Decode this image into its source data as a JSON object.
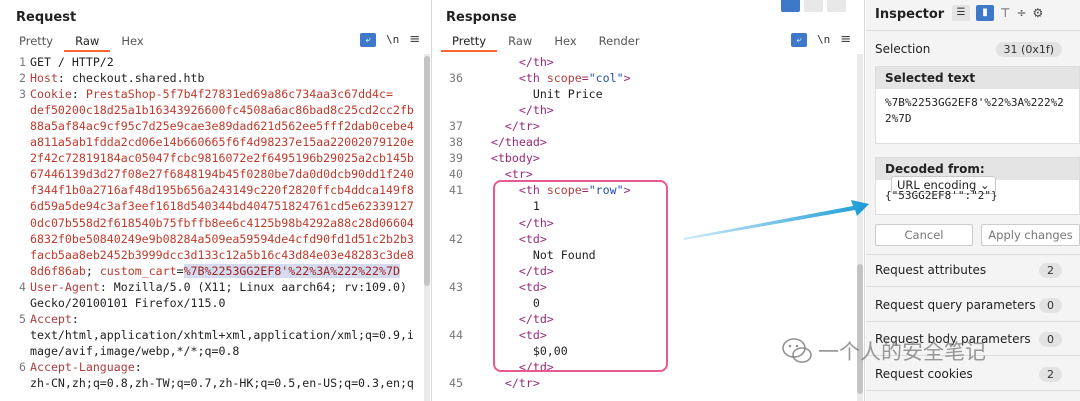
{
  "request": {
    "title": "Request",
    "tabs": [
      "Pretty",
      "Raw",
      "Hex"
    ],
    "active_tab": "Raw",
    "newline_label": "\\n",
    "lines": [
      {
        "n": "1",
        "parts": [
          {
            "c": "v",
            "t": "GET / HTTP/2"
          }
        ]
      },
      {
        "n": "2",
        "parts": [
          {
            "c": "k",
            "t": "Host"
          },
          {
            "c": "v",
            "t": ": checkout.shared.htb"
          }
        ]
      },
      {
        "n": "3",
        "parts": [
          {
            "c": "k",
            "t": "Cookie"
          },
          {
            "c": "v",
            "t": ": "
          },
          {
            "c": "ck",
            "t": "PrestaShop-5f7b4f27831ed69a86c734aa3c67dd4c="
          }
        ]
      },
      {
        "n": "",
        "parts": [
          {
            "c": "ck",
            "t": "def50200c18d25a1b16343926600fc4508a6ac86bad8c25cd2cc2fb"
          }
        ]
      },
      {
        "n": "",
        "parts": [
          {
            "c": "ck",
            "t": "88a5af84ac9cf95c7d25e9cae3e89dad621d562ee5fff2dab0cebe4"
          }
        ]
      },
      {
        "n": "",
        "parts": [
          {
            "c": "ck",
            "t": "a811a5ab1fdda2cd06e14b660665f6f4d98237e15aa22002079120e"
          }
        ]
      },
      {
        "n": "",
        "parts": [
          {
            "c": "ck",
            "t": "2f42c72819184ac05047fcbc9816072e2f6495196b29025a2cb145b"
          }
        ]
      },
      {
        "n": "",
        "parts": [
          {
            "c": "ck",
            "t": "67446139d3d27f08e27f6848194b45f0280be7da0d0dcb90dd1f240"
          }
        ]
      },
      {
        "n": "",
        "parts": [
          {
            "c": "ck",
            "t": "f344f1b0a2716af48d195b656a243149c220f2820ffcb4ddca149f8"
          }
        ]
      },
      {
        "n": "",
        "parts": [
          {
            "c": "ck",
            "t": "6d59a5de94c3af3eef1618d540344bd404751824761cd5e62339127"
          }
        ]
      },
      {
        "n": "",
        "parts": [
          {
            "c": "ck",
            "t": "0dc07b558d2f618540b75fbffb8ee6c4125b98b4292a88c28d06604"
          }
        ]
      },
      {
        "n": "",
        "parts": [
          {
            "c": "ck",
            "t": "6832f0be50840249e9b08284a509ea59594de4cfd90fd1d51c2b2b3"
          }
        ]
      },
      {
        "n": "",
        "parts": [
          {
            "c": "ck",
            "t": "facb5aa8eb2452b3999dcc3d133c12a5b16c43d84e03e48283c3de8"
          }
        ]
      },
      {
        "n": "",
        "parts": [
          {
            "c": "ck",
            "t": "8d6f86ab"
          },
          {
            "c": "v",
            "t": "; "
          },
          {
            "c": "ck",
            "t": "custom_cart"
          },
          {
            "c": "v",
            "t": "="
          },
          {
            "c": "hl",
            "t": "%7B%2253GG2EF8'%22%3A%222%22%7D"
          }
        ]
      },
      {
        "n": "4",
        "parts": [
          {
            "c": "k",
            "t": "User-Agent"
          },
          {
            "c": "v",
            "t": ": Mozilla/5.0 (X11; Linux aarch64; rv:109.0)"
          }
        ]
      },
      {
        "n": "",
        "parts": [
          {
            "c": "v",
            "t": "Gecko/20100101 Firefox/115.0"
          }
        ]
      },
      {
        "n": "5",
        "parts": [
          {
            "c": "k",
            "t": "Accept"
          },
          {
            "c": "v",
            "t": ":"
          }
        ]
      },
      {
        "n": "",
        "parts": [
          {
            "c": "v",
            "t": "text/html,application/xhtml+xml,application/xml;q=0.9,i"
          }
        ]
      },
      {
        "n": "",
        "parts": [
          {
            "c": "v",
            "t": "mage/avif,image/webp,*/*;q=0.8"
          }
        ]
      },
      {
        "n": "6",
        "parts": [
          {
            "c": "k",
            "t": "Accept-Language"
          },
          {
            "c": "v",
            "t": ":"
          }
        ]
      },
      {
        "n": "",
        "parts": [
          {
            "c": "v",
            "t": "zh-CN,zh;q=0.8,zh-TW;q=0.7,zh-HK;q=0.5,en-US;q=0.3,en;q"
          }
        ]
      }
    ]
  },
  "response": {
    "title": "Response",
    "tabs": [
      "Pretty",
      "Raw",
      "Hex",
      "Render"
    ],
    "active_tab": "Pretty",
    "newline_label": "\\n",
    "lines": [
      {
        "n": "",
        "parts": [
          {
            "c": "tag",
            "t": "      </th>"
          }
        ]
      },
      {
        "n": "36",
        "parts": [
          {
            "c": "tag",
            "t": "      <th "
          },
          {
            "c": "an",
            "t": "scope"
          },
          {
            "c": "tag",
            "t": "="
          },
          {
            "c": "av",
            "t": "\"col\""
          },
          {
            "c": "tag",
            "t": ">"
          }
        ]
      },
      {
        "n": "",
        "parts": [
          {
            "c": "v",
            "t": "        Unit Price"
          }
        ]
      },
      {
        "n": "",
        "parts": [
          {
            "c": "tag",
            "t": "      </th>"
          }
        ]
      },
      {
        "n": "37",
        "parts": [
          {
            "c": "tag",
            "t": "    </tr>"
          }
        ]
      },
      {
        "n": "38",
        "parts": [
          {
            "c": "tag",
            "t": "  </thead>"
          }
        ]
      },
      {
        "n": "39",
        "parts": [
          {
            "c": "tag",
            "t": "  <tbody>"
          }
        ]
      },
      {
        "n": "40",
        "parts": [
          {
            "c": "tag",
            "t": "    <tr>"
          }
        ]
      },
      {
        "n": "41",
        "parts": [
          {
            "c": "tag",
            "t": "      <th "
          },
          {
            "c": "an",
            "t": "scope"
          },
          {
            "c": "tag",
            "t": "="
          },
          {
            "c": "av",
            "t": "\"row\""
          },
          {
            "c": "tag",
            "t": ">"
          }
        ]
      },
      {
        "n": "",
        "parts": [
          {
            "c": "v",
            "t": "        1"
          }
        ]
      },
      {
        "n": "",
        "parts": [
          {
            "c": "tag",
            "t": "      </th>"
          }
        ]
      },
      {
        "n": "42",
        "parts": [
          {
            "c": "tag",
            "t": "      <td>"
          }
        ]
      },
      {
        "n": "",
        "parts": [
          {
            "c": "v",
            "t": "        Not Found"
          }
        ]
      },
      {
        "n": "",
        "parts": [
          {
            "c": "tag",
            "t": "      </td>"
          }
        ]
      },
      {
        "n": "43",
        "parts": [
          {
            "c": "tag",
            "t": "      <td>"
          }
        ]
      },
      {
        "n": "",
        "parts": [
          {
            "c": "v",
            "t": "        0"
          }
        ]
      },
      {
        "n": "",
        "parts": [
          {
            "c": "tag",
            "t": "      </td>"
          }
        ]
      },
      {
        "n": "44",
        "parts": [
          {
            "c": "tag",
            "t": "      <td>"
          }
        ]
      },
      {
        "n": "",
        "parts": [
          {
            "c": "v",
            "t": "        $0,00"
          }
        ]
      },
      {
        "n": "",
        "parts": [
          {
            "c": "tag",
            "t": "      </td>"
          }
        ]
      },
      {
        "n": "45",
        "parts": [
          {
            "c": "tag",
            "t": "    </tr>"
          }
        ]
      }
    ]
  },
  "inspector": {
    "title": "Inspector",
    "selection_label": "Selection",
    "selection_value": "31 (0x1f)",
    "selected_text_label": "Selected text",
    "selected_text_lines": [
      "%7B%2253GG2EF8'%22%3A%222%2",
      "2%7D"
    ],
    "decoded_from_label": "Decoded from:",
    "decoded_from_value": "URL encoding",
    "decoded_value": "{\"53GG2EF8'\":\"2\"}",
    "cancel_label": "Cancel",
    "apply_label": "Apply changes",
    "sections": [
      {
        "label": "Request attributes",
        "count": "2"
      },
      {
        "label": "Request query parameters",
        "count": "0"
      },
      {
        "label": "Request body parameters",
        "count": "0"
      },
      {
        "label": "Request cookies",
        "count": "2"
      }
    ]
  },
  "watermark": {
    "text": "一个人的安全笔记"
  },
  "colors": {
    "accent": "#ff6633",
    "highlight_box": "#e85a8f",
    "arrow": "#1a9bd7",
    "button_blue": "#3d78c9"
  }
}
